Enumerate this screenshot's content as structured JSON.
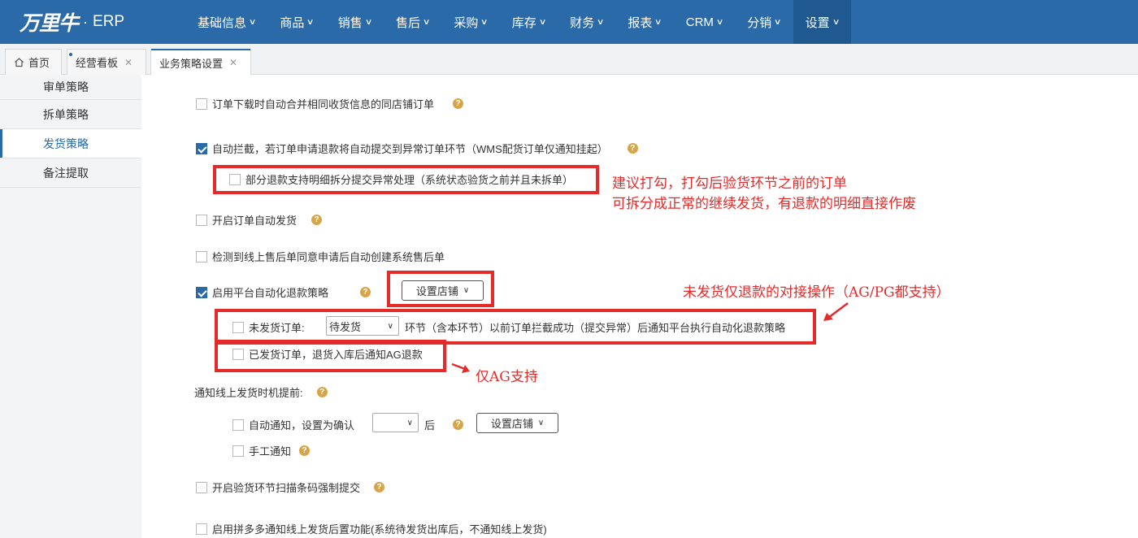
{
  "app": {
    "logo_text": "万里牛",
    "logo_dot": "·",
    "logo_erp": "ERP"
  },
  "nav": [
    {
      "label": "基础信息"
    },
    {
      "label": "商品"
    },
    {
      "label": "销售"
    },
    {
      "label": "售后"
    },
    {
      "label": "采购"
    },
    {
      "label": "库存"
    },
    {
      "label": "财务"
    },
    {
      "label": "报表"
    },
    {
      "label": "CRM"
    },
    {
      "label": "分销"
    },
    {
      "label": "设置",
      "active": true
    }
  ],
  "tabs": [
    {
      "label": "首页",
      "icon": "home-icon"
    },
    {
      "label": "经营看板",
      "closable": true
    },
    {
      "label": "业务策略设置",
      "closable": true,
      "active": true
    }
  ],
  "sidebar": [
    {
      "label": "审单策略"
    },
    {
      "label": "拆单策略"
    },
    {
      "label": "发货策略",
      "active": true
    },
    {
      "label": "备注提取"
    }
  ],
  "settings": {
    "merge_orders": {
      "label": "订单下载时自动合并相同收货信息的同店铺订单",
      "checked": false
    },
    "auto_intercept": {
      "label": "自动拦截，若订单申请退款将自动提交到异常订单环节（WMS配货订单仅通知挂起）",
      "checked": true
    },
    "partial_refund": {
      "label": "部分退款支持明细拆分提交异常处理（系统状态验货之前并且未拆单）",
      "checked": false
    },
    "auto_ship": {
      "label": "开启订单自动发货",
      "checked": false
    },
    "after_sale": {
      "label": "检测到线上售后单同意申请后自动创建系统售后单",
      "checked": false
    },
    "platform_refund": {
      "label": "启用平台自动化退款策略",
      "checked": true,
      "button": "设置店铺"
    },
    "unshipped": {
      "label": "未发货订单:",
      "checked": false,
      "select_value": "待发货",
      "suffix": "环节（含本环节）以前订单拦截成功（提交异常）后通知平台执行自动化退款策略"
    },
    "shipped": {
      "label": "已发货订单，退货入库后通知AG退款",
      "checked": false
    },
    "notify_title": "通知线上发货时机提前:",
    "auto_notify": {
      "label": "自动通知，设置为确认",
      "checked": false,
      "select_value": "",
      "after": "后",
      "button": "设置店铺"
    },
    "manual_notify": {
      "label": "手工通知",
      "checked": false
    },
    "scan_barcode": {
      "label": "开启验货环节扫描条码强制提交",
      "checked": false
    },
    "pdd_notify": {
      "label": "启用拼多多通知线上发货后置功能(系统待发货出库后，不通知线上发货)",
      "checked": false
    }
  },
  "annotations": {
    "note1_line1": "建议打勾，打勾后验货环节之前的订单",
    "note1_line2": "可拆分成正常的继续发货，有退款的明细直接作废",
    "note2": "未发货仅退款的对接操作（AG/PG都支持）",
    "note3": "仅AG支持"
  },
  "colors": {
    "nav_bg": "#2a6aa8",
    "accent": "#2a6aa8",
    "annotation": "#e52a2a",
    "help": "#d6a54a"
  }
}
